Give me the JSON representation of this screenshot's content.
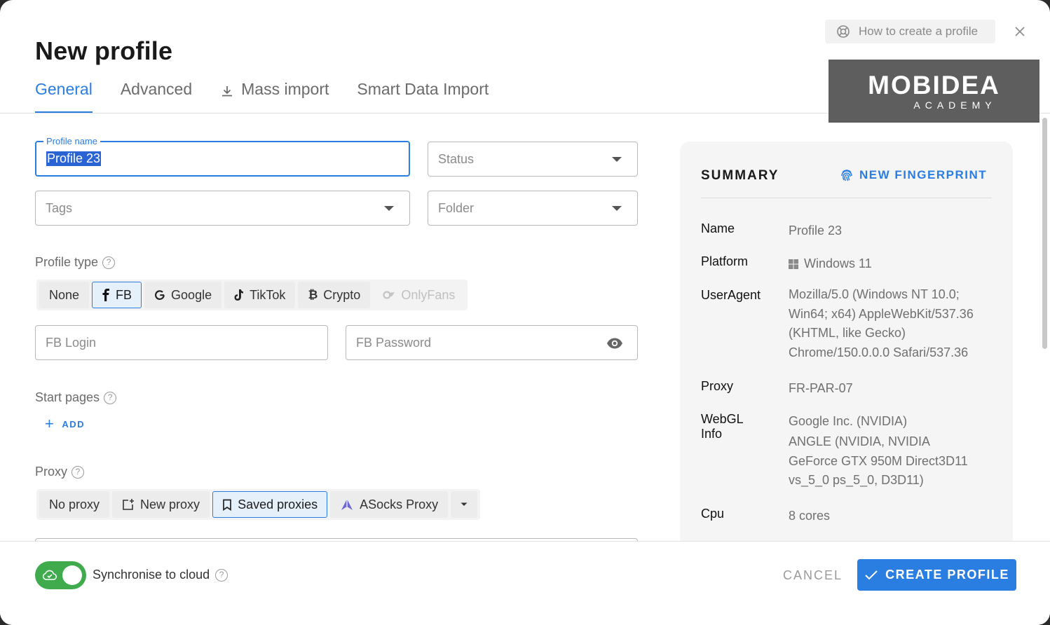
{
  "header": {
    "title": "New profile",
    "help_label": "How to create a profile",
    "tabs": [
      {
        "label": "General",
        "active": true
      },
      {
        "label": "Advanced",
        "active": false
      },
      {
        "label": "Mass import",
        "active": false
      },
      {
        "label": "Smart Data Import",
        "active": false
      }
    ]
  },
  "logo": {
    "main": "MOBIDEA",
    "sub": "ACADEMY"
  },
  "form": {
    "profile_name": {
      "label": "Profile name",
      "value": "Profile 23"
    },
    "status": {
      "placeholder": "Status"
    },
    "tags": {
      "placeholder": "Tags"
    },
    "folder": {
      "placeholder": "Folder"
    },
    "profile_type": {
      "label": "Profile type",
      "options": [
        {
          "label": "None",
          "icon": "none"
        },
        {
          "label": "FB",
          "icon": "facebook-icon",
          "active": true
        },
        {
          "label": "Google",
          "icon": "google-icon"
        },
        {
          "label": "TikTok",
          "icon": "tiktok-icon"
        },
        {
          "label": "Crypto",
          "icon": "bitcoin-icon"
        },
        {
          "label": "OnlyFans",
          "icon": "onlyfans-icon",
          "disabled": true
        }
      ]
    },
    "fb_login": {
      "placeholder": "FB Login"
    },
    "fb_password": {
      "placeholder": "FB Password"
    },
    "start_pages": {
      "label": "Start pages",
      "add_label": "ADD"
    },
    "proxy": {
      "label": "Proxy",
      "options": [
        {
          "label": "No proxy"
        },
        {
          "label": "New proxy",
          "icon": "new-proxy-icon"
        },
        {
          "label": "Saved proxies",
          "icon": "bookmark-icon",
          "active": true
        },
        {
          "label": "ASocks Proxy",
          "icon": "asocks-icon"
        }
      ]
    }
  },
  "summary": {
    "title": "SUMMARY",
    "new_fingerprint": "NEW FINGERPRINT",
    "rows": [
      {
        "key": "Name",
        "value": "Profile 23"
      },
      {
        "key": "Platform",
        "value": "Windows 11"
      },
      {
        "key": "UserAgent",
        "value": "Mozilla/5.0 (Windows NT 10.0; Win64; x64) AppleWebKit/537.36 (KHTML, like Gecko) Chrome/150.0.0.0 Safari/537.36"
      },
      {
        "key": "Proxy",
        "value": "FR-PAR-07"
      },
      {
        "key": "WebGL Info",
        "value": "Google Inc. (NVIDIA)",
        "value2": "ANGLE (NVIDIA, NVIDIA GeForce GTX 950M Direct3D11 vs_5_0 ps_5_0, D3D11)"
      },
      {
        "key": "Cpu",
        "value": "8 cores"
      }
    ]
  },
  "footer": {
    "sync_label": "Synchronise to cloud",
    "sync_enabled": true,
    "cancel_label": "CANCEL",
    "create_label": "CREATE PROFILE"
  },
  "colors": {
    "accent": "#2a7de1",
    "toggle_on": "#3fab4c"
  }
}
